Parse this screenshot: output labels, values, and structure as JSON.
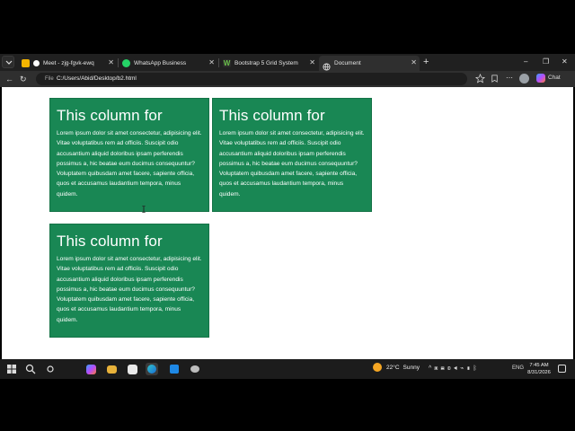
{
  "browser": {
    "tabs": [
      {
        "label": "Meet - zjg-fgvk-ewq",
        "icon": "meet-icon"
      },
      {
        "label": "WhatsApp Business",
        "icon": "whatsapp-icon"
      },
      {
        "label": "Bootstrap 5 Grid System",
        "icon": "bootstrap-icon"
      },
      {
        "label": "Document",
        "icon": "globe-icon",
        "active": true
      }
    ],
    "address": {
      "prefix": "File",
      "url": "C:/Users/Abid/Desktop/b2.html"
    },
    "window_controls": {
      "minimize": "–",
      "restore": "❐",
      "close": "✕"
    },
    "copilot_label": "Chat"
  },
  "page": {
    "columns": [
      {
        "heading": "This column for",
        "body": "Lorem ipsum dolor sit amet consectetur, adipisicing elit. Vitae voluptatibus rem ad officiis. Suscipit odio accusantium aliquid doloribus ipsam perferendis possimus a, hic beatae eum ducimus consequuntur? Voluptatem quibusdam amet facere, sapiente officia, quos et accusamus laudantium tempora, minus quidem."
      },
      {
        "heading": "This column for",
        "body": "Lorem ipsum dolor sit amet consectetur, adipisicing elit. Vitae voluptatibus rem ad officiis. Suscipit odio accusantium aliquid doloribus ipsam perferendis possimus a, hic beatae eum ducimus consequuntur? Voluptatem quibusdam amet facere, sapiente officia, quos et accusamus laudantium tempora, minus quidem."
      },
      {
        "heading": "This column for",
        "body": "Lorem ipsum dolor sit amet consectetur, adipisicing elit. Vitae voluptatibus rem ad officiis. Suscipit odio accusantium aliquid doloribus ipsam perferendis possimus a, hic beatae eum ducimus consequuntur? Voluptatem quibusdam amet facere, sapiente officia, quos et accusamus laudantium tempora, minus quidem."
      }
    ],
    "card_color": "#198754"
  },
  "taskbar": {
    "weather": {
      "temp": "22°C",
      "condition": "Sunny"
    },
    "language": "ENG",
    "time": "7:45 AM",
    "date": "8/31/2026"
  }
}
